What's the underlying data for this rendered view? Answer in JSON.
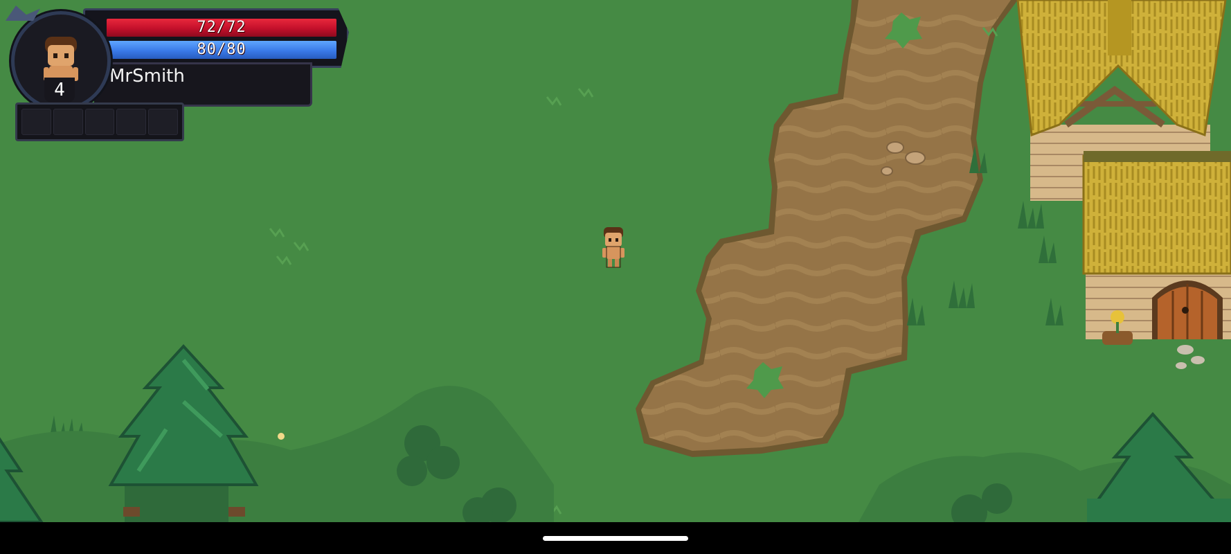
{
  "player": {
    "name": "MrSmith",
    "level": "4",
    "hp_text": "72/72",
    "hp_fraction": 1.0,
    "mp_text": "80/80",
    "mp_fraction": 1.0
  },
  "skill_slots": [
    "",
    "",
    "",
    "",
    ""
  ],
  "colors": {
    "grass": "#458a44",
    "path": "#957447",
    "thatch": "#d1b43a",
    "hp": "#c3102b",
    "mp": "#3a7ae8"
  },
  "icons": {
    "portrait": "player-portrait-icon",
    "character": "player-character-sprite"
  }
}
